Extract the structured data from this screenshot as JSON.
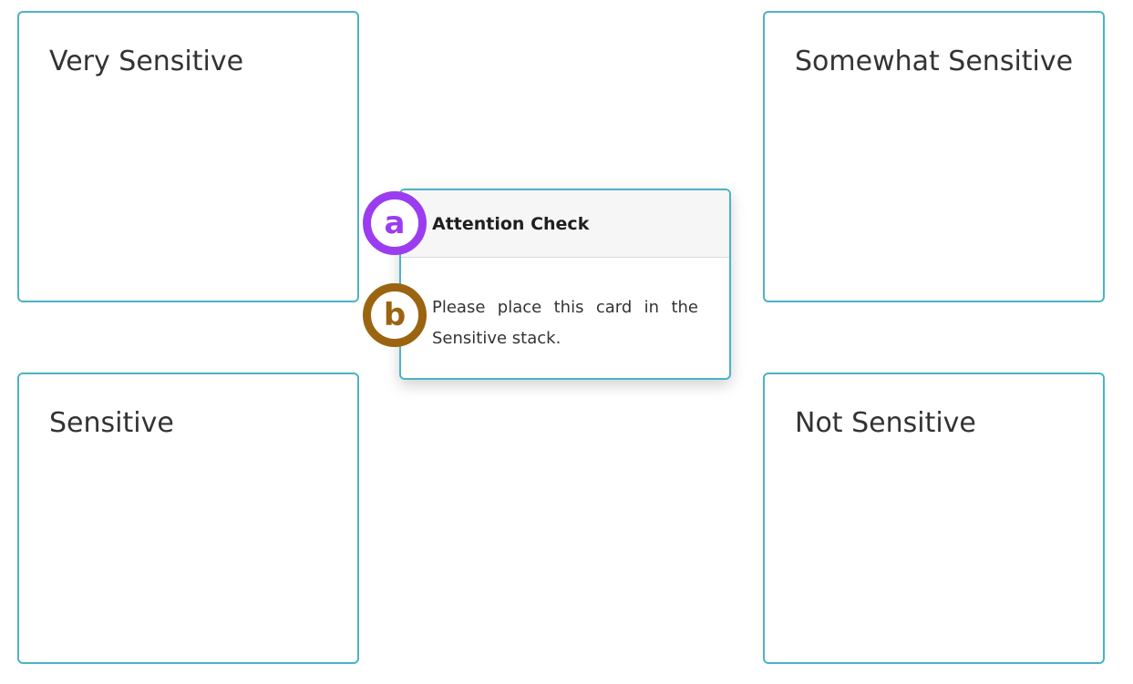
{
  "stacks": {
    "top_left": "Very Sensitive",
    "top_right": "Somewhat Sensitive",
    "bottom_left": "Sensitive",
    "bottom_right": "Not Sensitive"
  },
  "card": {
    "title": "Attention Check",
    "body": "Please place this card in the Sensitive stack."
  },
  "markers": {
    "a": "a",
    "b": "b"
  },
  "colors": {
    "border": "#4bb3c4",
    "marker_a": "#9b3cf0",
    "marker_b": "#9a6410"
  }
}
